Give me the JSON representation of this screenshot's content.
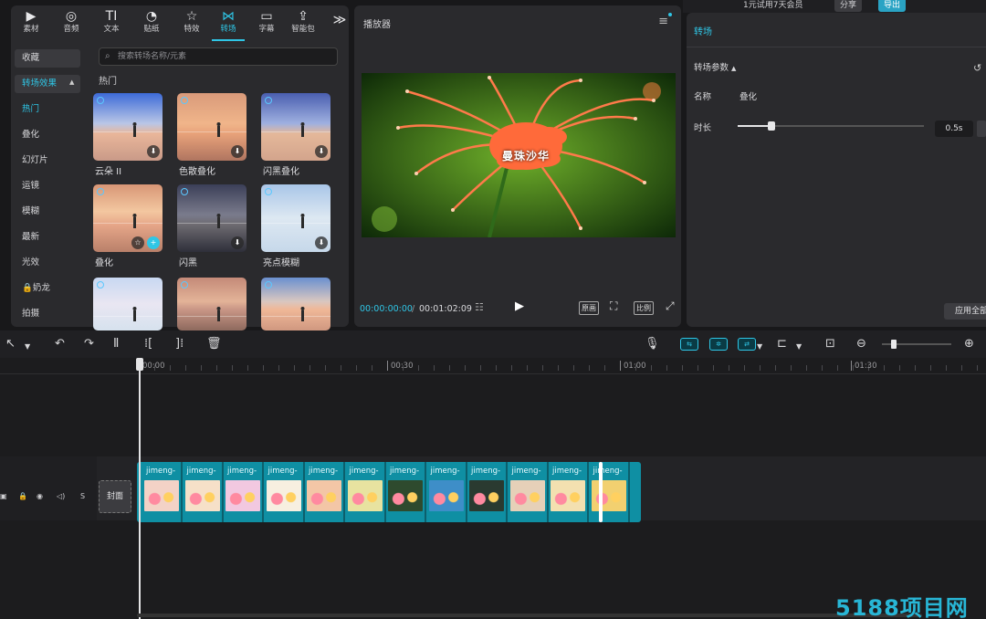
{
  "top_strip": {
    "account_label": "1元试用7天会员",
    "share_label": "分享",
    "export_label": "导出"
  },
  "media_panel": {
    "tabs": [
      {
        "label": "素材",
        "icon": "film-icon",
        "glyph": "▶"
      },
      {
        "label": "音频",
        "icon": "audio-icon",
        "glyph": "◎"
      },
      {
        "label": "文本",
        "icon": "text-icon",
        "glyph": "TI"
      },
      {
        "label": "贴纸",
        "icon": "sticker-icon",
        "glyph": "◔"
      },
      {
        "label": "特效",
        "icon": "effects-icon",
        "glyph": "☆"
      },
      {
        "label": "转场",
        "icon": "transition-icon",
        "glyph": "⋈"
      },
      {
        "label": "字幕",
        "icon": "subtitle-icon",
        "glyph": "▭"
      },
      {
        "label": "智能包",
        "icon": "smart-pack-icon",
        "glyph": "⇪"
      }
    ],
    "more_glyph": "≫",
    "active_tab": "转场",
    "nav": [
      {
        "label": "收藏"
      },
      {
        "label": "转场效果"
      },
      {
        "label": "热门"
      },
      {
        "label": "叠化"
      },
      {
        "label": "幻灯片"
      },
      {
        "label": "运镜"
      },
      {
        "label": "模糊"
      },
      {
        "label": "最新"
      },
      {
        "label": "光效"
      },
      {
        "label": "🔒奶龙"
      },
      {
        "label": "拍摄"
      }
    ],
    "search_placeholder": "搜索转场名称/元素",
    "section_title": "热门",
    "items": [
      {
        "label": "云朵 II"
      },
      {
        "label": "色散叠化"
      },
      {
        "label": "闪黑叠化"
      },
      {
        "label": "叠化"
      },
      {
        "label": "闪黑"
      },
      {
        "label": "亮点模糊"
      },
      {
        "label": ""
      },
      {
        "label": ""
      },
      {
        "label": ""
      }
    ]
  },
  "player": {
    "title": "播放器",
    "video_overlay_text": "曼珠沙华",
    "current_time": "00:00:00:00",
    "separator": "/",
    "total_time": "00:01:02:09",
    "buttons": {
      "full_quality": "原画",
      "ratio": "比例"
    }
  },
  "transition_panel": {
    "title": "转场",
    "params_label": "转场参数",
    "name_label": "名称",
    "name_value": "叠化",
    "duration_label": "时长",
    "duration_value": "0.5s",
    "duration_fraction": 0.18,
    "apply_all_label": "应用全部"
  },
  "timeline": {
    "ruler_labels": [
      "00:00",
      "00:30",
      "01:00",
      "01:30"
    ],
    "cover_label": "封面",
    "track_icons": {
      "lock": "🔒",
      "eye": "◉",
      "audio": "◁)",
      "s": "S"
    },
    "clips": [
      {
        "label": "jimeng-"
      },
      {
        "label": "jimeng-"
      },
      {
        "label": "jimeng-"
      },
      {
        "label": "jimeng-"
      },
      {
        "label": "jimeng-"
      },
      {
        "label": "jimeng-"
      },
      {
        "label": "jimeng-"
      },
      {
        "label": "jimeng-"
      },
      {
        "label": "jimeng-"
      },
      {
        "label": "jimeng-"
      },
      {
        "label": "jimeng-"
      },
      {
        "label": "jimeng-"
      }
    ]
  },
  "watermark": "5188项目网",
  "colors": {
    "accent": "#2fc6e6",
    "clip": "#0f8fa3",
    "panel": "#2a2a2d"
  }
}
